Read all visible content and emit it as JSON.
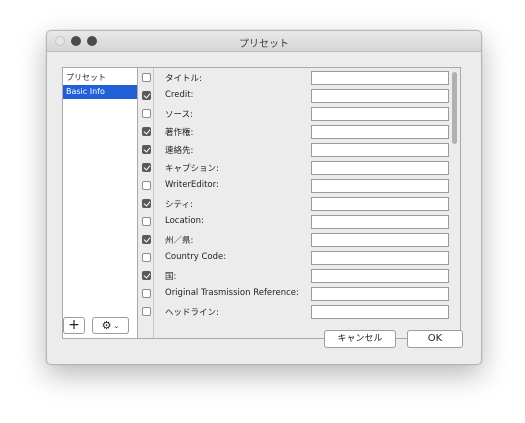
{
  "window": {
    "title": "プリセット"
  },
  "sidebar": {
    "items": [
      {
        "label": "プリセット",
        "selected": false
      },
      {
        "label": "Basic Info",
        "selected": true
      }
    ]
  },
  "fields": [
    {
      "label": "タイトル:",
      "checked": false,
      "value": ""
    },
    {
      "label": "Credit:",
      "checked": true,
      "value": ""
    },
    {
      "label": "ソース:",
      "checked": false,
      "value": ""
    },
    {
      "label": "著作権:",
      "checked": true,
      "value": ""
    },
    {
      "label": "連絡先:",
      "checked": true,
      "value": ""
    },
    {
      "label": "キャプション:",
      "checked": true,
      "value": ""
    },
    {
      "label": "WriterEditor:",
      "checked": false,
      "value": ""
    },
    {
      "label": "シティ:",
      "checked": true,
      "value": ""
    },
    {
      "label": "Location:",
      "checked": false,
      "value": ""
    },
    {
      "label": "州／県:",
      "checked": true,
      "value": ""
    },
    {
      "label": "Country Code:",
      "checked": false,
      "value": ""
    },
    {
      "label": "国:",
      "checked": true,
      "value": ""
    },
    {
      "label": "Original Trasmission Reference:",
      "checked": false,
      "value": ""
    },
    {
      "label": "ヘッドライン:",
      "checked": false,
      "value": ""
    }
  ],
  "buttons": {
    "add": "+",
    "cancel": "キャンセル",
    "ok": "OK"
  },
  "icons": {
    "add": "plus-icon",
    "action": "gear-icon",
    "menu": "chevron-down-icon"
  },
  "colors": {
    "selection": "#2160d6",
    "window_bg": "#ececec"
  }
}
